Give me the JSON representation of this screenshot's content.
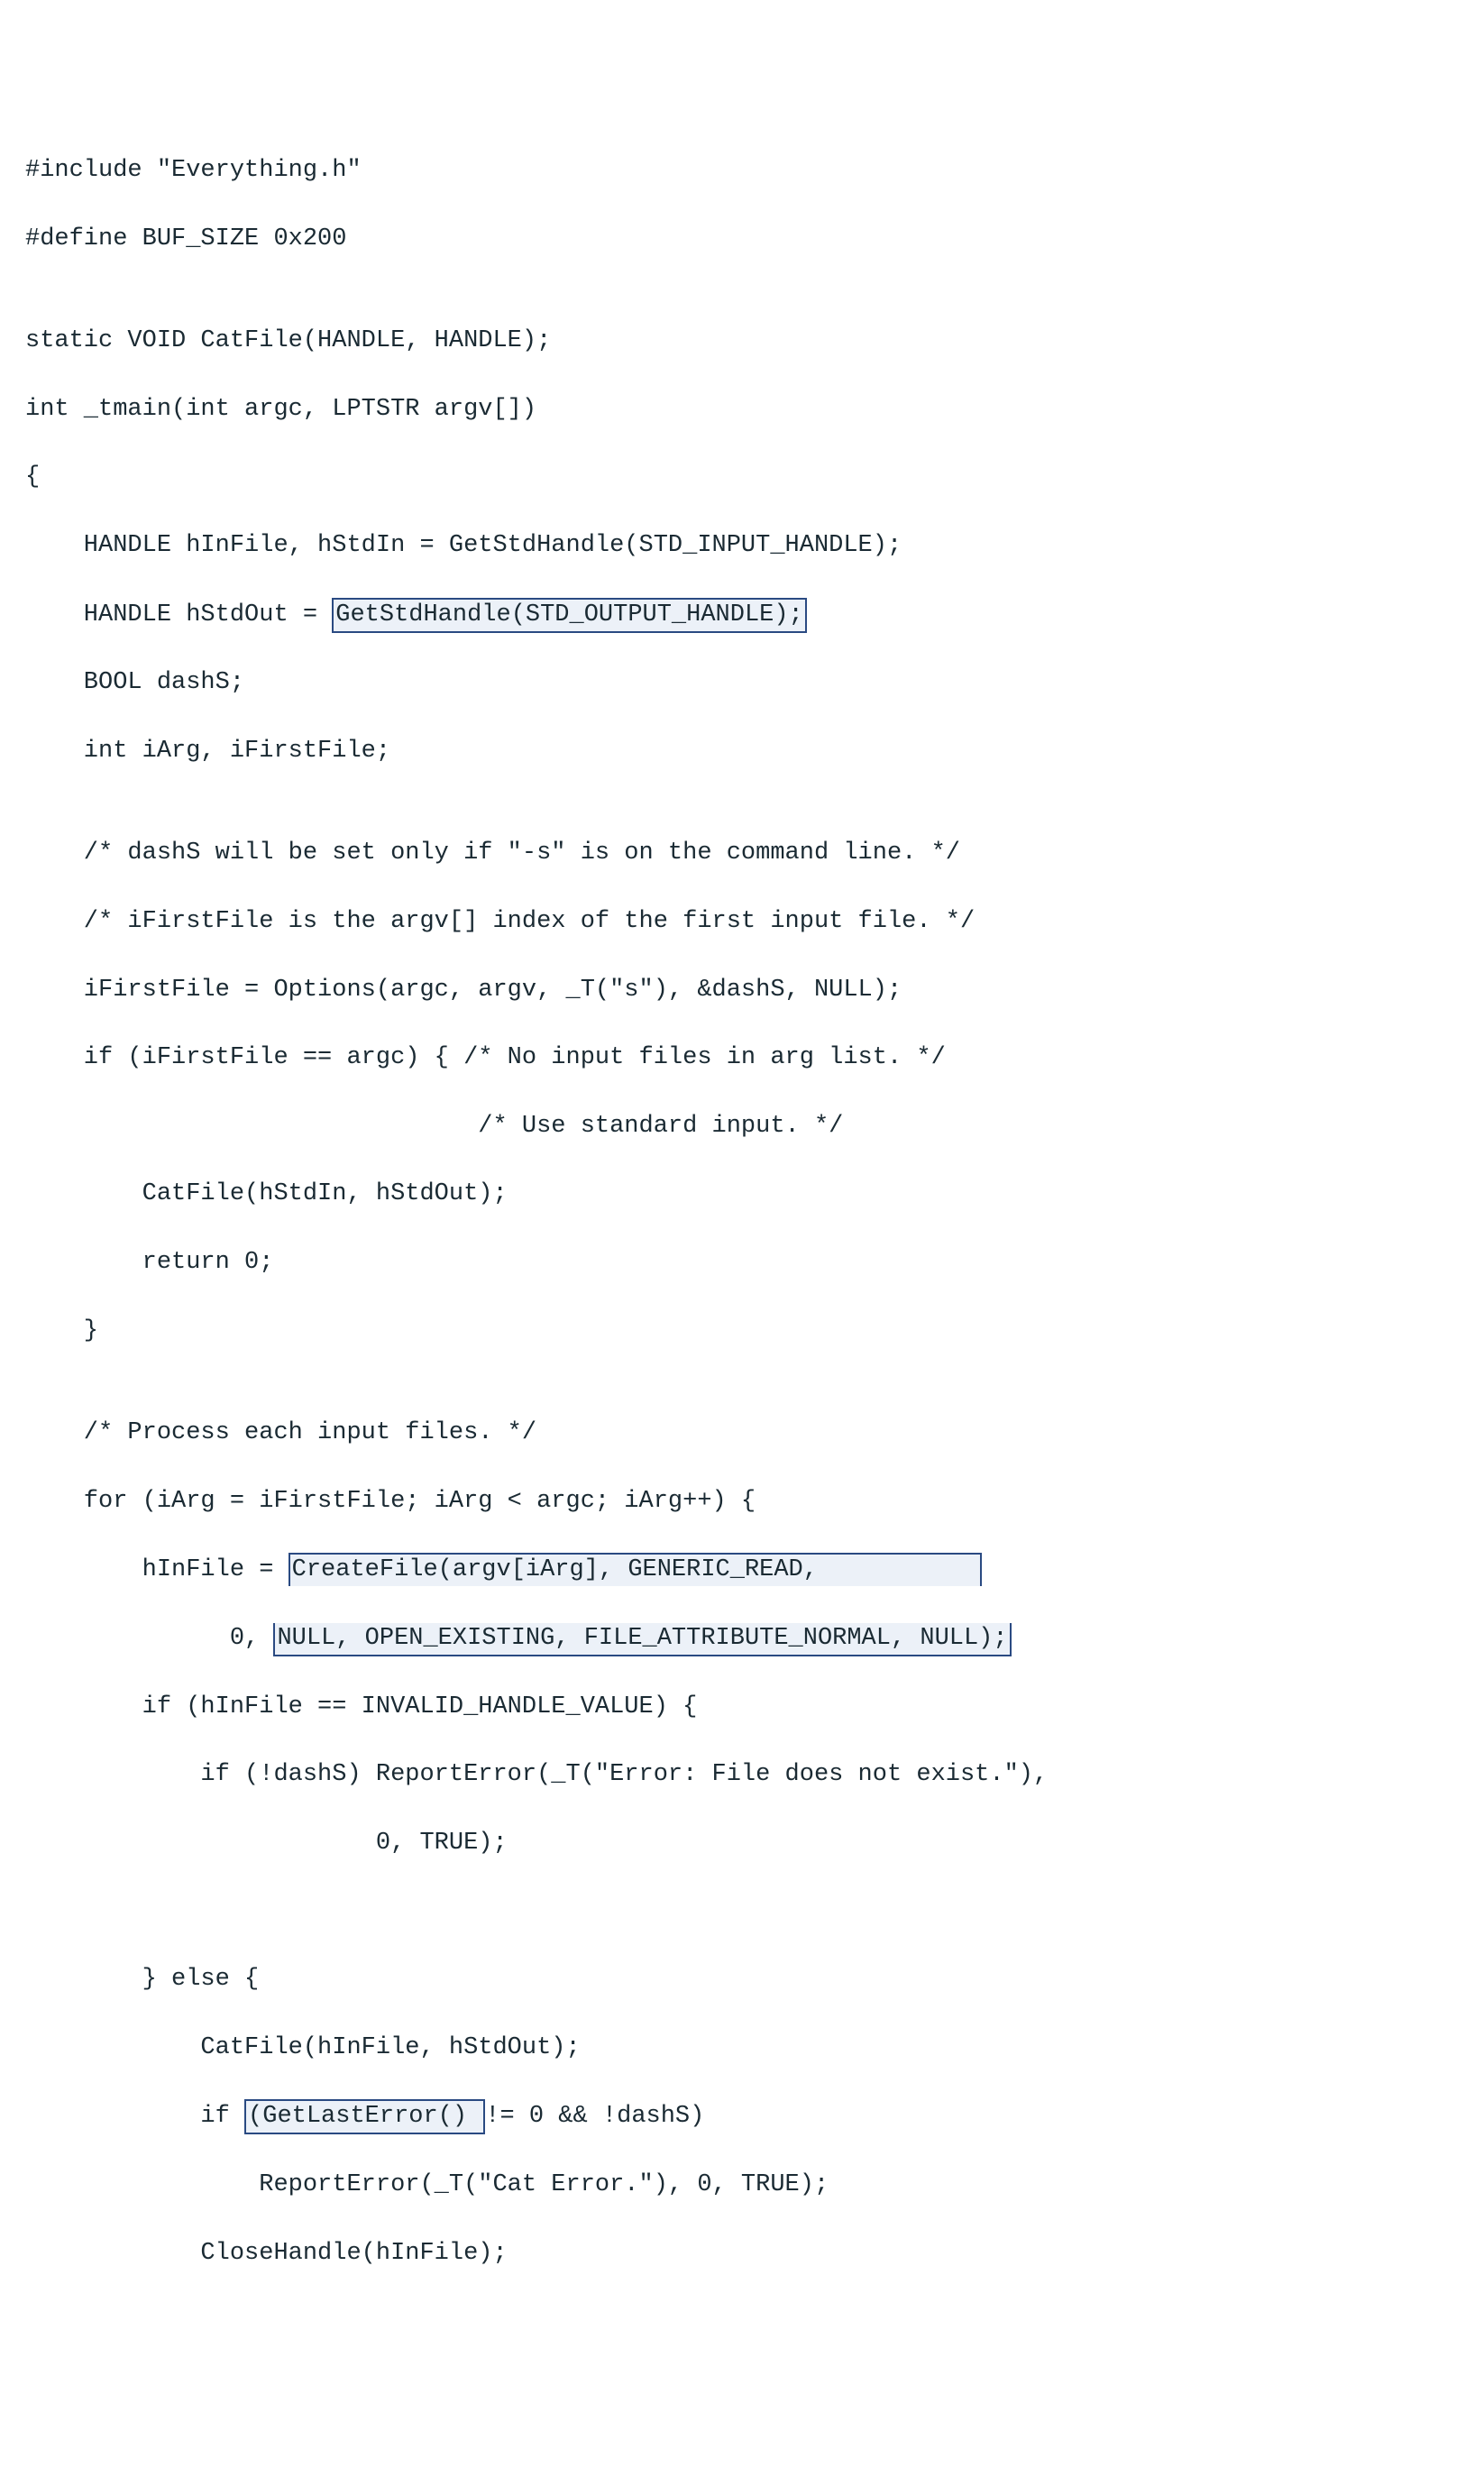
{
  "code": {
    "l01": "#include \"Everything.h\"",
    "l02": "#define BUF_SIZE 0x200",
    "l03": "",
    "l04": "static VOID CatFile(HANDLE, HANDLE);",
    "l05": "int _tmain(int argc, LPTSTR argv[])",
    "l06": "{",
    "l07a": "    HANDLE hInFile, hStdIn = GetStdHandle(STD_INPUT_HANDLE);",
    "l08a": "    HANDLE hStdOut = ",
    "l08b": "GetStdHandle(STD_OUTPUT_HANDLE);",
    "l09": "    BOOL dashS;",
    "l10": "    int iArg, iFirstFile;",
    "l11": "",
    "l12": "    /* dashS will be set only if \"-s\" is on the command line. */",
    "l13": "    /* iFirstFile is the argv[] index of the first input file. */",
    "l14": "    iFirstFile = Options(argc, argv, _T(\"s\"), &dashS, NULL);",
    "l15": "    if (iFirstFile == argc) { /* No input files in arg list. */",
    "l16": "                               /* Use standard input. */",
    "l17": "        CatFile(hStdIn, hStdOut);",
    "l18": "        return 0;",
    "l19": "    }",
    "l20": "",
    "l21": "    /* Process each input files. */",
    "l22": "    for (iArg = iFirstFile; iArg < argc; iArg++) {",
    "l23a": "        hInFile = ",
    "l23b": "CreateFile(argv[iArg], GENERIC_READ,           ",
    "l24a": "              0, ",
    "l24b": "NULL, OPEN_EXISTING, FILE_ATTRIBUTE_NORMAL, NULL);",
    "l25": "        if (hInFile == INVALID_HANDLE_VALUE) {",
    "l26": "            if (!dashS) ReportError(_T(\"Error: File does not exist.\"),",
    "l27": "                        0, TRUE);",
    "l28": "",
    "l29": "",
    "l30": "        } else {",
    "l31": "            CatFile(hInFile, hStdOut);",
    "l32a": "            if ",
    "l32b": "(GetLastError() ",
    "l32c": "!= 0 && !dashS)",
    "l33": "                ReportError(_T(\"Cat Error.\"), 0, TRUE);",
    "l34": "            CloseHandle(hInFile);"
  },
  "highlights": {
    "h1_desc": "GetStdHandle(STD_OUTPUT_HANDLE);",
    "h2_desc": "CreateFile(...) call (two-line box)",
    "h3_desc": "(GetLastError() "
  }
}
